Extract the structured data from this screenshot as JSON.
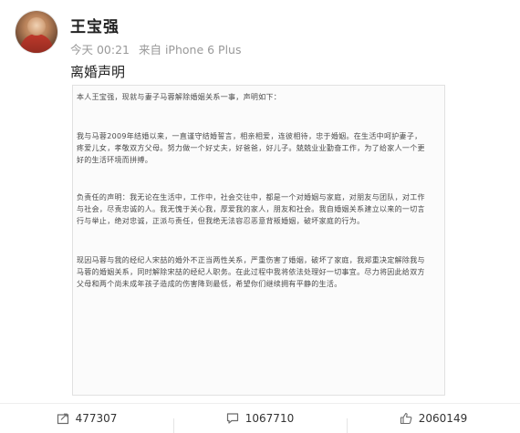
{
  "post": {
    "username": "王宝强",
    "time": "今天 00:21",
    "source": "来自 iPhone 6 Plus",
    "title": "离婚声明"
  },
  "statement": {
    "paragraphs": [
      "本人王宝强，现就与妻子马蓉解除婚姻关系一事，声明如下：",
      "我与马蓉2009年结婚以来，一直谨守结婚誓言，相亲相爱，连彼相待，忠于婚姻。在生活中呵护妻子，疼爱儿女，孝敬双方父母。努力做一个好丈夫，好爸爸，好儿子。兢兢业业勤奋工作，为了给家人一个更好的生活环境而拼搏。",
      "负责任的声明：我无论在生活中，工作中，社会交往中，都是一个对婚姻与家庭，对朋友与团队，对工作与社会，尽责忠诚的人。我无愧于关心我，厚爱我的家人，朋友和社会。我自婚姻关系建立以来的一切言行与举止，绝对忠诚，正派与责任，但我绝无法容忍恶意背叛婚姻，破坏家庭的行为。",
      "现因马蓉与我的经纪人宋喆的婚外不正当两性关系，严重伤害了婚姻，破坏了家庭，我郑重决定解除我与马蓉的婚姻关系，同时解除宋喆的经纪人职务。在此过程中我将依法处理好一切事宜。尽力将因此给双方父母和两个尚未成年孩子造成的伤害降到最低，希望你们继续拥有平静的生活。"
    ]
  },
  "actions": {
    "share_count": "477307",
    "comment_count": "1067710",
    "like_count": "2060149"
  },
  "icons": {
    "share": "share-icon",
    "comment": "comment-icon",
    "like": "thumbs-up-icon"
  }
}
